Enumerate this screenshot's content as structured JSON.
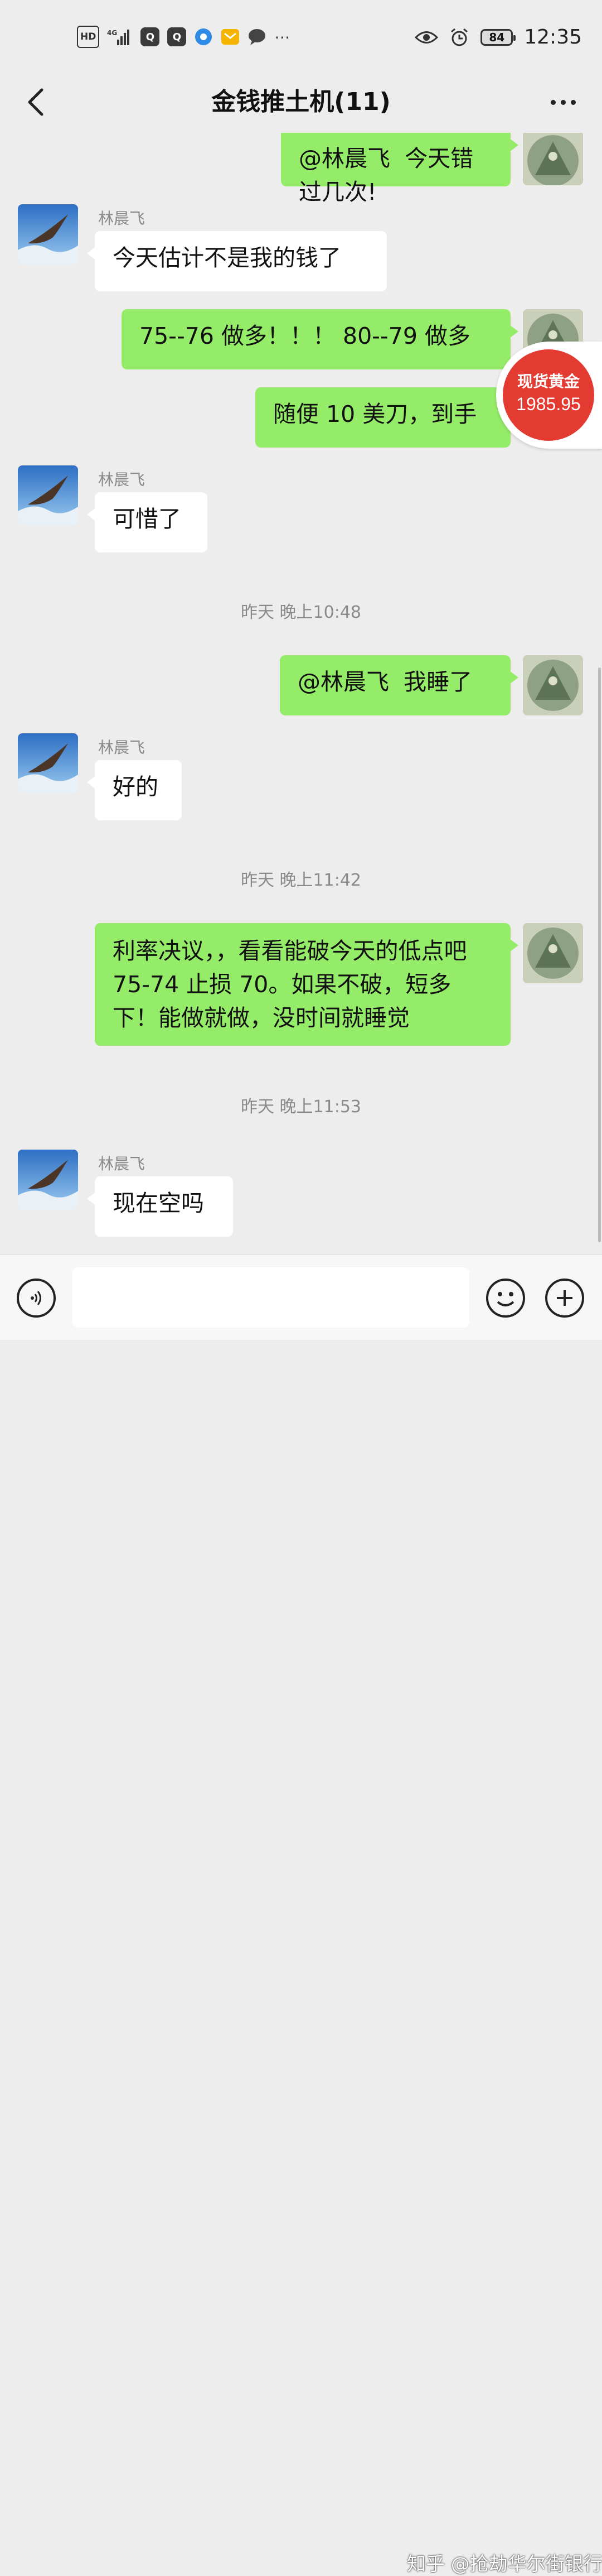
{
  "status_bar": {
    "network": "HD",
    "signal": "4G",
    "battery": "84",
    "time": "12:35"
  },
  "nav": {
    "title": "金钱推土机(11)"
  },
  "messages": [
    {
      "side": "me",
      "text": "@林晨飞  今天错过几次!"
    },
    {
      "side": "other",
      "sender": "林晨飞",
      "text": "今天估计不是我的钱了"
    },
    {
      "side": "me",
      "text": "75--76 做多！！！ 80--79 做多"
    },
    {
      "side": "me",
      "text": "随便 10 美刀，到手"
    },
    {
      "side": "other",
      "sender": "林晨飞",
      "text": "可惜了"
    },
    {
      "type": "time",
      "text": "昨天 晚上10:48"
    },
    {
      "side": "me",
      "text": "@林晨飞  我睡了"
    },
    {
      "side": "other",
      "sender": "林晨飞",
      "text": "好的"
    },
    {
      "type": "time",
      "text": "昨天 晚上11:42"
    },
    {
      "side": "me",
      "text": "利率决议，，看看能破今天的低点吧 75-74 止损 70。如果不破，短多下！能做就做，没时间就睡觉"
    },
    {
      "type": "time",
      "text": "昨天 晚上11:53"
    },
    {
      "side": "other",
      "sender": "林晨飞",
      "text": "现在空吗"
    }
  ],
  "gold_badge": {
    "label": "现货黄金",
    "price": "1985.95"
  },
  "input": {
    "placeholder": ""
  },
  "watermark": "知乎 @抢劫华尔街银行",
  "colors": {
    "my_bubble": "#95ec69",
    "other_bubble": "#ffffff",
    "background": "#ededed",
    "badge": "#e33b32"
  }
}
